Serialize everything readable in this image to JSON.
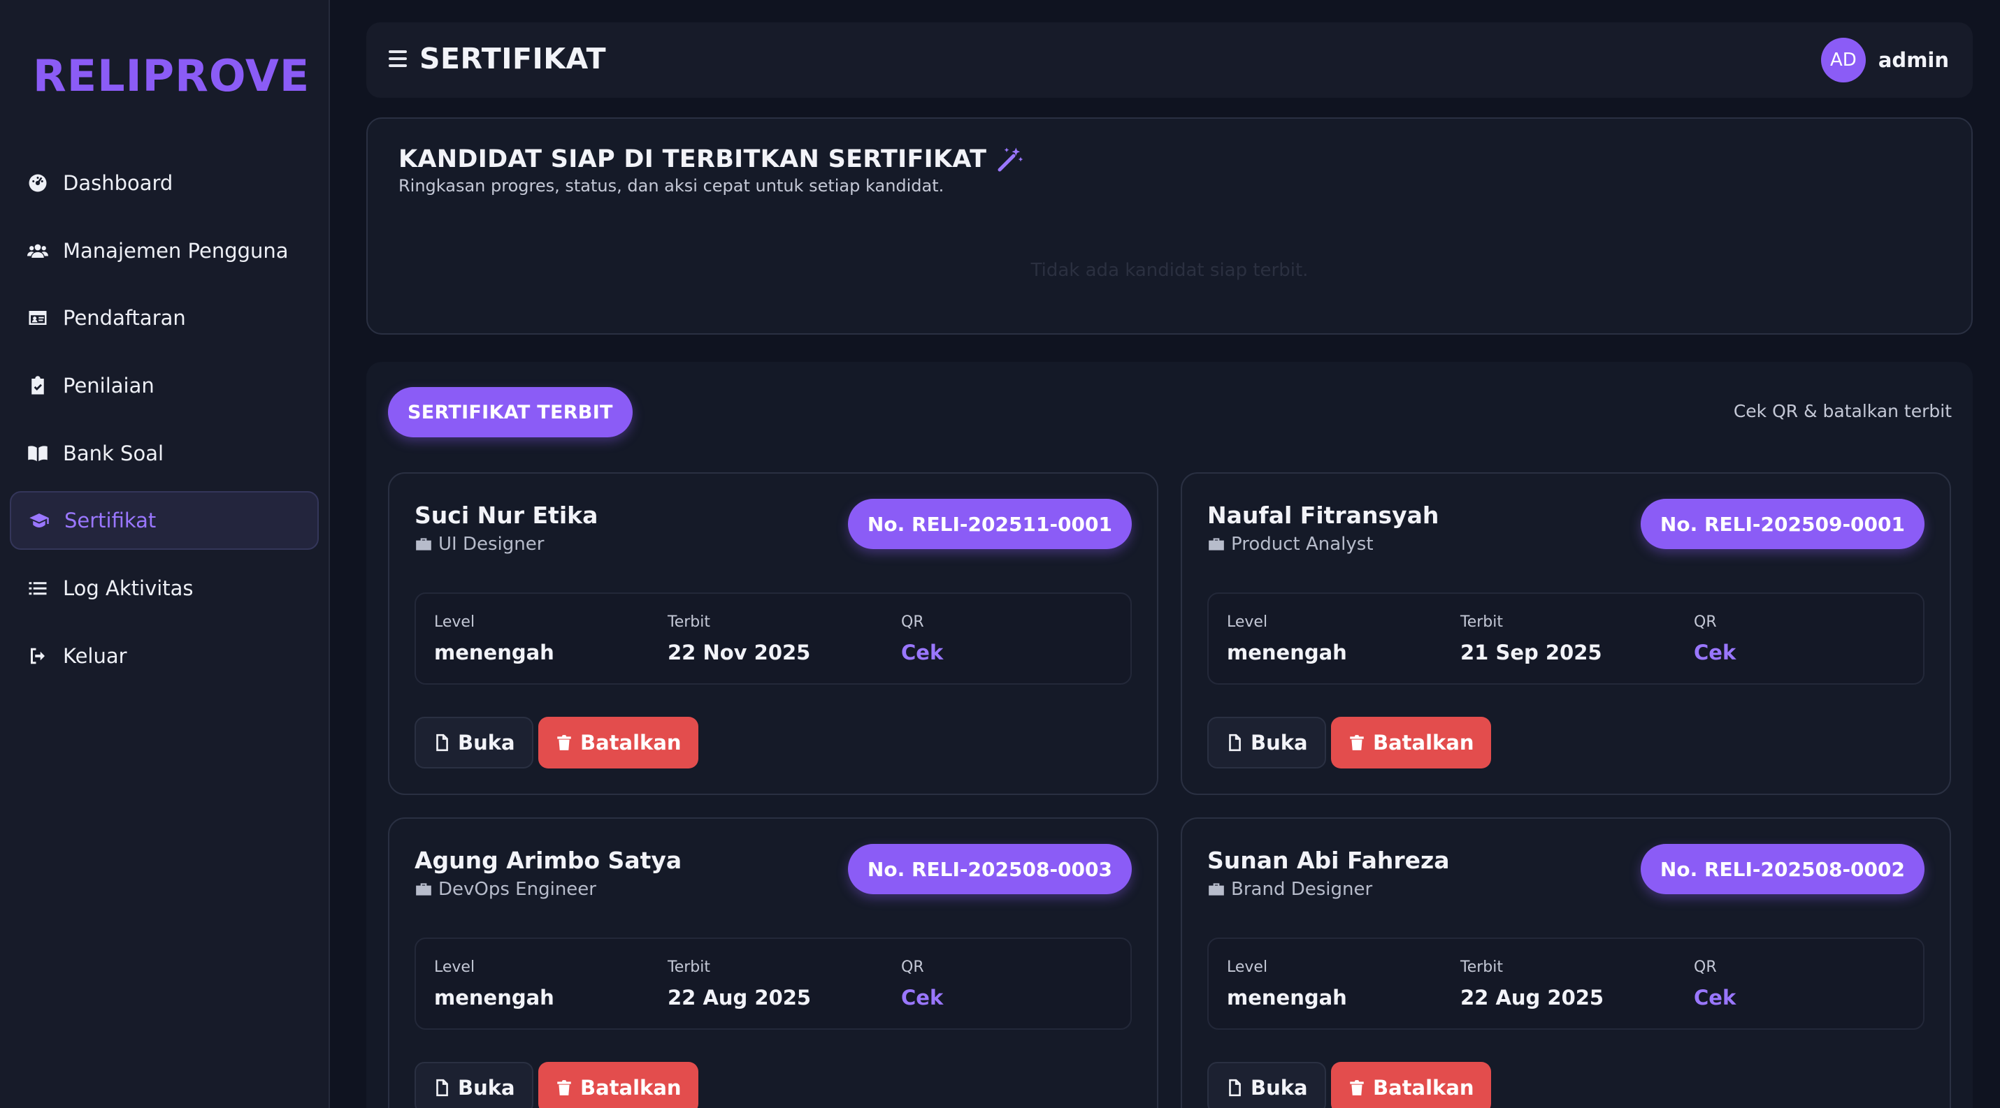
{
  "brand": "RELIPROVE",
  "sidebar": {
    "items": [
      {
        "label": "Dashboard",
        "icon": "dashboard-icon"
      },
      {
        "label": "Manajemen Pengguna",
        "icon": "users-icon"
      },
      {
        "label": "Pendaftaran",
        "icon": "id-card-icon"
      },
      {
        "label": "Penilaian",
        "icon": "clipboard-check-icon"
      },
      {
        "label": "Bank Soal",
        "icon": "book-open-icon"
      },
      {
        "label": "Sertifikat",
        "icon": "graduation-cap-icon",
        "active": true
      },
      {
        "label": "Log Aktivitas",
        "icon": "list-icon"
      },
      {
        "label": "Keluar",
        "icon": "logout-icon"
      }
    ]
  },
  "header": {
    "title": "SERTIFIKAT",
    "user": {
      "initials": "AD",
      "name": "admin"
    }
  },
  "ready": {
    "title": "KANDIDAT SIAP DI TERBITKAN SERTIFIKAT",
    "subtitle": "Ringkasan progres, status, dan aksi cepat untuk setiap kandidat.",
    "empty": "Tidak ada kandidat siap terbit."
  },
  "certificates": {
    "title": "SERTIFIKAT TERBIT",
    "hint": "Cek QR & batalkan terbit",
    "labels": {
      "level": "Level",
      "issued": "Terbit",
      "qr": "QR",
      "qr_action": "Cek",
      "open": "Buka",
      "cancel": "Batalkan"
    },
    "items": [
      {
        "name": "Suci Nur Etika",
        "role": "UI Designer",
        "number": "No. RELI-202511-0001",
        "level": "menengah",
        "issued": "22 Nov 2025"
      },
      {
        "name": "Naufal Fitransyah",
        "role": "Product Analyst",
        "number": "No. RELI-202509-0001",
        "level": "menengah",
        "issued": "21 Sep 2025"
      },
      {
        "name": "Agung Arimbo Satya",
        "role": "DevOps Engineer",
        "number": "No. RELI-202508-0003",
        "level": "menengah",
        "issued": "22 Aug 2025"
      },
      {
        "name": "Sunan Abi Fahreza",
        "role": "Brand Designer",
        "number": "No. RELI-202508-0002",
        "level": "menengah",
        "issued": "22 Aug 2025"
      }
    ]
  },
  "colors": {
    "accent": "#8b5cf6",
    "danger": "#e34d4d",
    "background": "#0f1320"
  }
}
